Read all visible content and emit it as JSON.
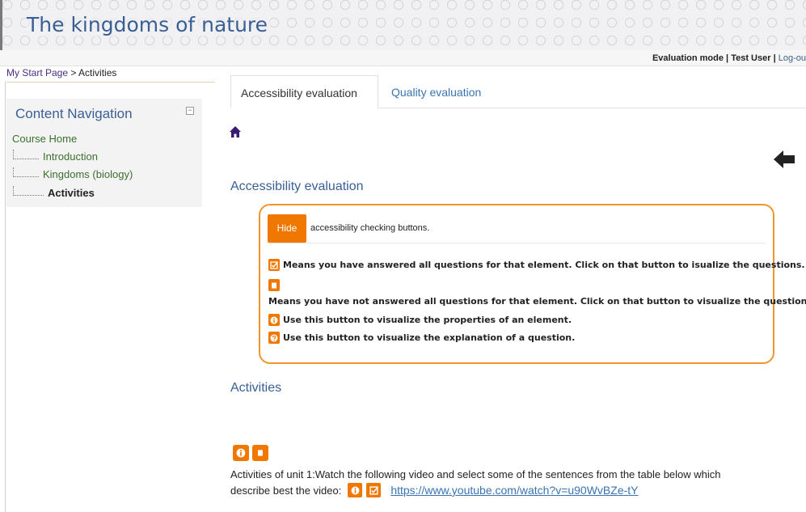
{
  "header": {
    "title": "The kingdoms of nature"
  },
  "userbar": {
    "mode": "Evaluation mode",
    "user": "Test User",
    "logout": "Log-ou"
  },
  "breadcrumb": {
    "home": "My Start Page",
    "separator": " > ",
    "current": "Activities"
  },
  "sidebar": {
    "title": "Content Navigation",
    "collapse_symbol": "−",
    "home": "Course Home",
    "items": [
      {
        "label": "Introduction"
      },
      {
        "label": "Kingdoms (biology)"
      },
      {
        "label": "Activities",
        "current": true
      }
    ]
  },
  "tabs": [
    {
      "label": "Accessibility evaluation",
      "active": true
    },
    {
      "label": "Quality evaluation",
      "active": false
    }
  ],
  "main": {
    "section_title": "Accessibility evaluation",
    "hide_button": "Hide",
    "hide_text": "accessibility checking buttons.",
    "legend": {
      "answered": "Means you have answered all questions for that element. Click on that button to isualize the questions.",
      "not_answered": "Means you have not answered all questions for that element. Click on that button to visualize the questions.",
      "properties": "Use this button to visualize the properties of an element.",
      "explanation": "Use this button to visualize the explanation of a question."
    },
    "activities_title": "Activities",
    "activity_text_1": "Activities of unit 1:Watch the following video and select some of the sentences from the table below which",
    "activity_text_2": "describe best the video:",
    "video_link": "https://www.youtube.com/watch?v=u90WvBZe-tY"
  },
  "icons": {
    "home": "home-icon",
    "back": "back-arrow-icon",
    "info": "info-icon",
    "check": "checked-icon",
    "empty": "unchecked-icon",
    "question": "question-icon"
  },
  "colors": {
    "accent_orange": "#f07800",
    "title_blue": "#3a5f95",
    "link_blue": "#3a74b0",
    "nav_green": "#3b6f2e"
  }
}
